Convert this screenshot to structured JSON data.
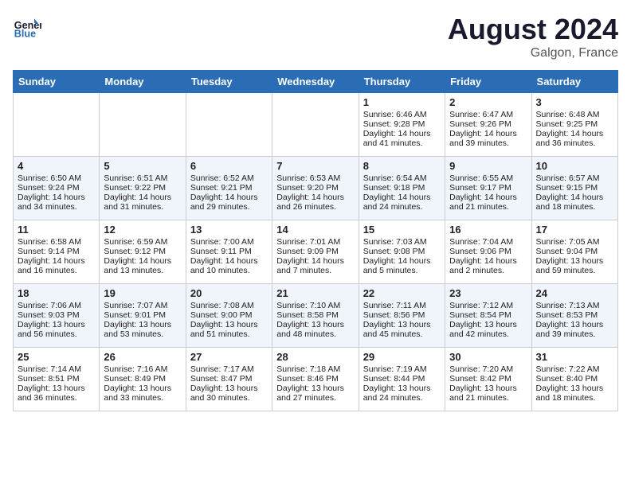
{
  "header": {
    "logo_line1": "General",
    "logo_line2": "Blue",
    "month_year": "August 2024",
    "location": "Galgon, France"
  },
  "days_of_week": [
    "Sunday",
    "Monday",
    "Tuesday",
    "Wednesday",
    "Thursday",
    "Friday",
    "Saturday"
  ],
  "weeks": [
    [
      {
        "day": "",
        "info": ""
      },
      {
        "day": "",
        "info": ""
      },
      {
        "day": "",
        "info": ""
      },
      {
        "day": "",
        "info": ""
      },
      {
        "day": "1",
        "info": "Sunrise: 6:46 AM\nSunset: 9:28 PM\nDaylight: 14 hours\nand 41 minutes."
      },
      {
        "day": "2",
        "info": "Sunrise: 6:47 AM\nSunset: 9:26 PM\nDaylight: 14 hours\nand 39 minutes."
      },
      {
        "day": "3",
        "info": "Sunrise: 6:48 AM\nSunset: 9:25 PM\nDaylight: 14 hours\nand 36 minutes."
      }
    ],
    [
      {
        "day": "4",
        "info": "Sunrise: 6:50 AM\nSunset: 9:24 PM\nDaylight: 14 hours\nand 34 minutes."
      },
      {
        "day": "5",
        "info": "Sunrise: 6:51 AM\nSunset: 9:22 PM\nDaylight: 14 hours\nand 31 minutes."
      },
      {
        "day": "6",
        "info": "Sunrise: 6:52 AM\nSunset: 9:21 PM\nDaylight: 14 hours\nand 29 minutes."
      },
      {
        "day": "7",
        "info": "Sunrise: 6:53 AM\nSunset: 9:20 PM\nDaylight: 14 hours\nand 26 minutes."
      },
      {
        "day": "8",
        "info": "Sunrise: 6:54 AM\nSunset: 9:18 PM\nDaylight: 14 hours\nand 24 minutes."
      },
      {
        "day": "9",
        "info": "Sunrise: 6:55 AM\nSunset: 9:17 PM\nDaylight: 14 hours\nand 21 minutes."
      },
      {
        "day": "10",
        "info": "Sunrise: 6:57 AM\nSunset: 9:15 PM\nDaylight: 14 hours\nand 18 minutes."
      }
    ],
    [
      {
        "day": "11",
        "info": "Sunrise: 6:58 AM\nSunset: 9:14 PM\nDaylight: 14 hours\nand 16 minutes."
      },
      {
        "day": "12",
        "info": "Sunrise: 6:59 AM\nSunset: 9:12 PM\nDaylight: 14 hours\nand 13 minutes."
      },
      {
        "day": "13",
        "info": "Sunrise: 7:00 AM\nSunset: 9:11 PM\nDaylight: 14 hours\nand 10 minutes."
      },
      {
        "day": "14",
        "info": "Sunrise: 7:01 AM\nSunset: 9:09 PM\nDaylight: 14 hours\nand 7 minutes."
      },
      {
        "day": "15",
        "info": "Sunrise: 7:03 AM\nSunset: 9:08 PM\nDaylight: 14 hours\nand 5 minutes."
      },
      {
        "day": "16",
        "info": "Sunrise: 7:04 AM\nSunset: 9:06 PM\nDaylight: 14 hours\nand 2 minutes."
      },
      {
        "day": "17",
        "info": "Sunrise: 7:05 AM\nSunset: 9:04 PM\nDaylight: 13 hours\nand 59 minutes."
      }
    ],
    [
      {
        "day": "18",
        "info": "Sunrise: 7:06 AM\nSunset: 9:03 PM\nDaylight: 13 hours\nand 56 minutes."
      },
      {
        "day": "19",
        "info": "Sunrise: 7:07 AM\nSunset: 9:01 PM\nDaylight: 13 hours\nand 53 minutes."
      },
      {
        "day": "20",
        "info": "Sunrise: 7:08 AM\nSunset: 9:00 PM\nDaylight: 13 hours\nand 51 minutes."
      },
      {
        "day": "21",
        "info": "Sunrise: 7:10 AM\nSunset: 8:58 PM\nDaylight: 13 hours\nand 48 minutes."
      },
      {
        "day": "22",
        "info": "Sunrise: 7:11 AM\nSunset: 8:56 PM\nDaylight: 13 hours\nand 45 minutes."
      },
      {
        "day": "23",
        "info": "Sunrise: 7:12 AM\nSunset: 8:54 PM\nDaylight: 13 hours\nand 42 minutes."
      },
      {
        "day": "24",
        "info": "Sunrise: 7:13 AM\nSunset: 8:53 PM\nDaylight: 13 hours\nand 39 minutes."
      }
    ],
    [
      {
        "day": "25",
        "info": "Sunrise: 7:14 AM\nSunset: 8:51 PM\nDaylight: 13 hours\nand 36 minutes."
      },
      {
        "day": "26",
        "info": "Sunrise: 7:16 AM\nSunset: 8:49 PM\nDaylight: 13 hours\nand 33 minutes."
      },
      {
        "day": "27",
        "info": "Sunrise: 7:17 AM\nSunset: 8:47 PM\nDaylight: 13 hours\nand 30 minutes."
      },
      {
        "day": "28",
        "info": "Sunrise: 7:18 AM\nSunset: 8:46 PM\nDaylight: 13 hours\nand 27 minutes."
      },
      {
        "day": "29",
        "info": "Sunrise: 7:19 AM\nSunset: 8:44 PM\nDaylight: 13 hours\nand 24 minutes."
      },
      {
        "day": "30",
        "info": "Sunrise: 7:20 AM\nSunset: 8:42 PM\nDaylight: 13 hours\nand 21 minutes."
      },
      {
        "day": "31",
        "info": "Sunrise: 7:22 AM\nSunset: 8:40 PM\nDaylight: 13 hours\nand 18 minutes."
      }
    ]
  ]
}
